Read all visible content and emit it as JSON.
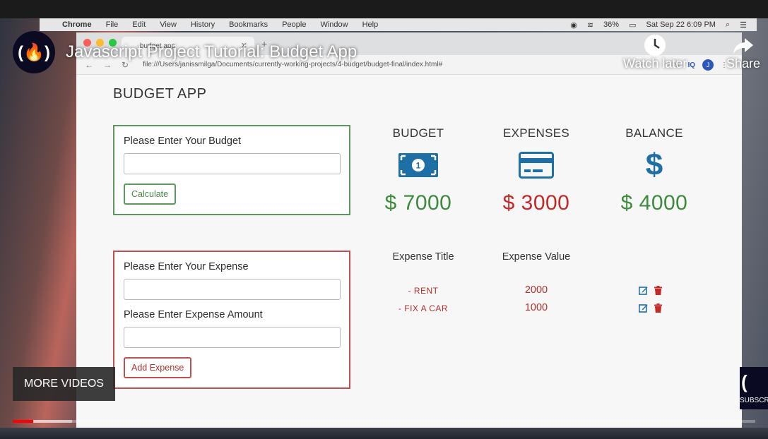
{
  "video": {
    "title": "Javascript Project Tutorial: Budget App",
    "logo_glyph": "(🔥)",
    "watch_later_label": "Watch later",
    "share_label": "Share",
    "more_videos_label": "MORE VIDEOS",
    "subscribe_label": "SUBSCR",
    "progress_fraction": 0.028,
    "buffer_fraction": 0.08
  },
  "menubar": {
    "items": [
      "Chrome",
      "File",
      "Edit",
      "View",
      "History",
      "Bookmarks",
      "People",
      "Window",
      "Help"
    ],
    "battery": "36%",
    "datetime": "Sat Sep 22  6:09 PM"
  },
  "browser": {
    "tab_title": "budget app",
    "url": "file:///Users/janissmilga/Documents/currently-working-projects/4-budget/budget-final/index.html#",
    "avatar_letter": "J",
    "ext_label": "IQ"
  },
  "app": {
    "title": "BUDGET APP",
    "budget_form": {
      "label": "Please Enter Your Budget",
      "value": "",
      "button": "Calculate"
    },
    "expense_form": {
      "title_label": "Please Enter Your Expense",
      "title_value": "",
      "amount_label": "Please Enter Expense Amount",
      "amount_value": "",
      "button": "Add Expense"
    },
    "stats": {
      "budget": {
        "heading": "BUDGET",
        "amount": "$ 7000",
        "icon": "money-bill-icon"
      },
      "expenses": {
        "heading": "EXPENSES",
        "amount": "$ 3000",
        "icon": "credit-card-icon"
      },
      "balance": {
        "heading": "BALANCE",
        "amount": "$ 4000",
        "icon": "dollar-sign-icon"
      }
    },
    "expense_list": {
      "title_header": "Expense Title",
      "value_header": "Expense Value",
      "rows": [
        {
          "title": "- RENT",
          "value": "2000"
        },
        {
          "title": "- FIX A CAR",
          "value": "1000"
        }
      ]
    }
  },
  "colors": {
    "green": "#3d8b3d",
    "red": "#c62828",
    "blue": "#1d6fa5",
    "green_border": "#5c9a5c",
    "red_border": "#c0504d"
  }
}
